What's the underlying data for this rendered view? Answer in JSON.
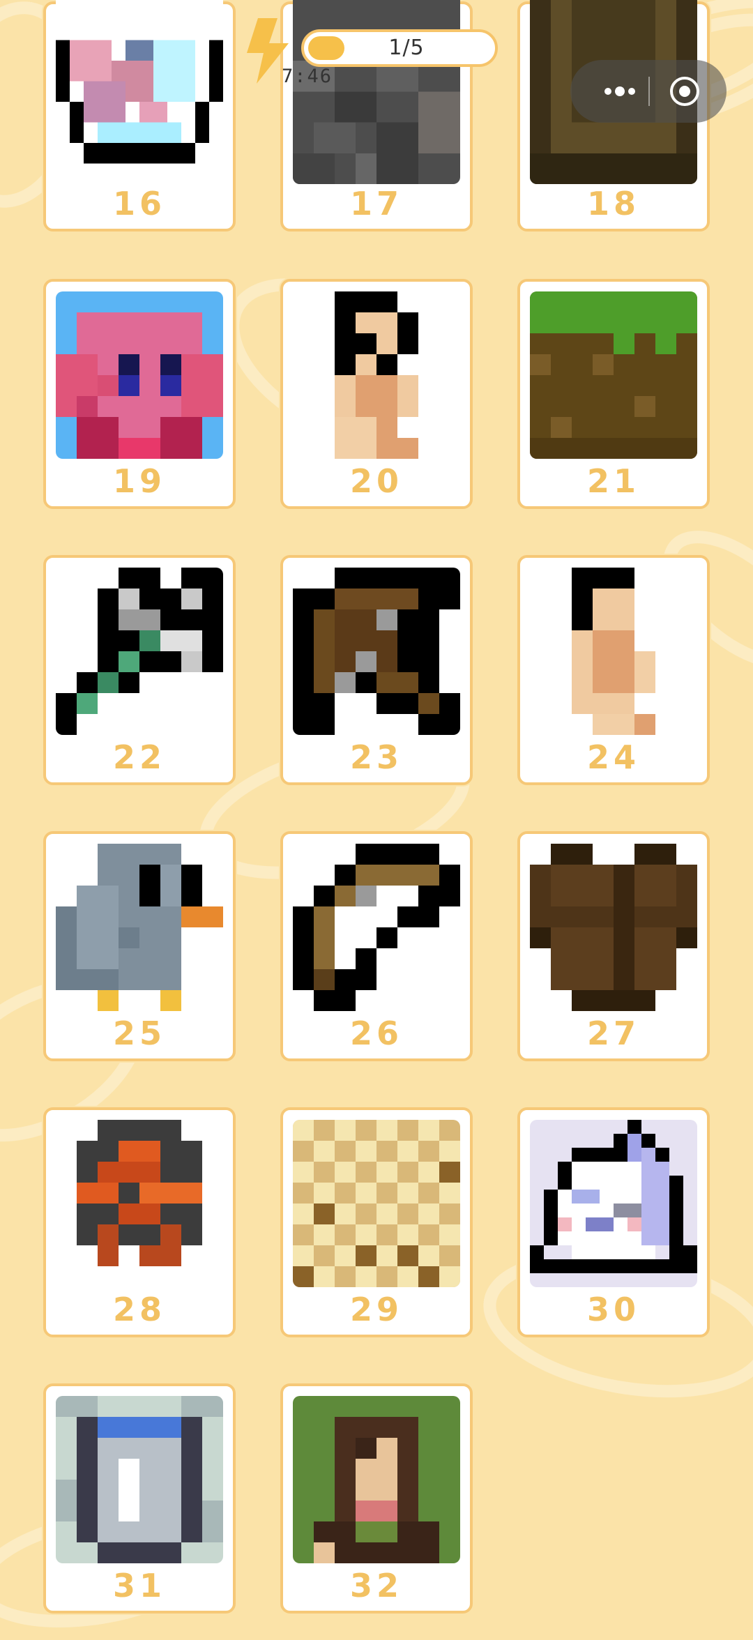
{
  "header": {
    "energy_count": "1/5",
    "timer": "7:46"
  },
  "levels": [
    {
      "number": "16"
    },
    {
      "number": "17"
    },
    {
      "number": "18"
    },
    {
      "number": "19"
    },
    {
      "number": "20"
    },
    {
      "number": "21"
    },
    {
      "number": "22"
    },
    {
      "number": "23"
    },
    {
      "number": "24"
    },
    {
      "number": "25"
    },
    {
      "number": "26"
    },
    {
      "number": "27"
    },
    {
      "number": "28"
    },
    {
      "number": "29"
    },
    {
      "number": "30"
    },
    {
      "number": "31"
    },
    {
      "number": "32"
    }
  ],
  "colors": {
    "background": "#fbe3a8",
    "accent": "#f6c877",
    "number": "#f2c162"
  }
}
